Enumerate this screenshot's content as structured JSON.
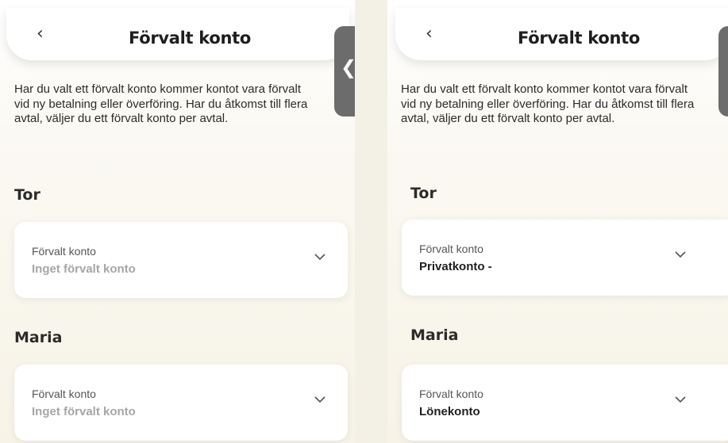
{
  "screens": [
    {
      "back_icon": "‹",
      "title": "Förvalt konto",
      "intro": "Har du valt ett förvalt konto kommer kontot vara förvalt vid ny betalning eller överföring. Har du åtkomst till flera avtal, väljer du ett förvalt konto per avtal.",
      "groups": [
        {
          "name": "Tor",
          "card_label": "Förvalt konto",
          "card_value": "Inget förvalt konto"
        },
        {
          "name": "Maria",
          "card_label": "Förvalt konto",
          "card_value": "Inget förvalt konto"
        }
      ]
    },
    {
      "back_icon": "‹",
      "title": "Förvalt konto",
      "intro": "Har du valt ett förvalt konto kommer kontot vara förvalt vid ny betalning eller överföring. Har du åtkomst till flera avtal, väljer du ett förvalt konto per avtal.",
      "groups": [
        {
          "name": "Tor",
          "card_label": "Förvalt konto",
          "card_value": "Privatkonto -"
        },
        {
          "name": "Maria",
          "card_label": "Förvalt konto",
          "card_value": "Lönekonto"
        }
      ]
    }
  ],
  "side_tab_icon": "❮",
  "colors": {
    "muted_value": "#a6a6a6",
    "side_tab": "#6c6c6c"
  }
}
